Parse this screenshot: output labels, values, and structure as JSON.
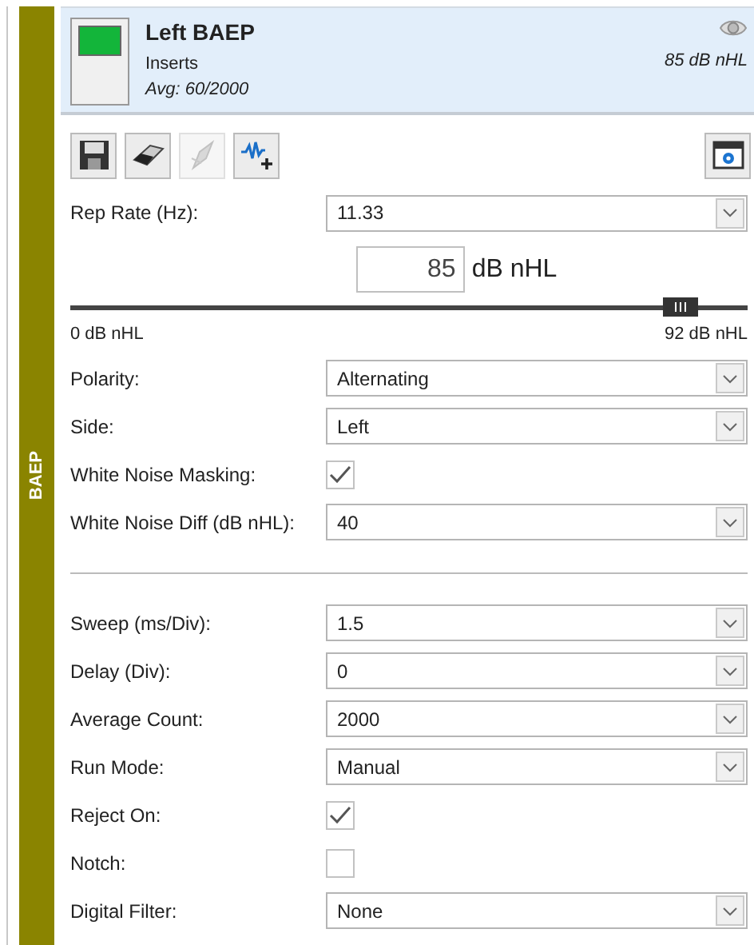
{
  "side_tab": {
    "label": "BAEP"
  },
  "header": {
    "title": "Left BAEP",
    "transducer": "Inserts",
    "average": "Avg: 60/2000",
    "intensity": "85 dB nHL",
    "visible": true
  },
  "toolbar": [
    {
      "kind": "save",
      "disabled": false
    },
    {
      "kind": "eraser",
      "disabled": false
    },
    {
      "kind": "marker",
      "disabled": true
    },
    {
      "kind": "add-wave",
      "disabled": false
    }
  ],
  "toolbar_right": {
    "kind": "settings",
    "disabled": false
  },
  "sections": [
    {
      "rows": [
        {
          "kind": "select",
          "label": "Rep Rate (Hz):",
          "value": "11.33"
        },
        {
          "kind": "slider",
          "value": "85",
          "unit": "dB nHL",
          "level": 0.9,
          "min_label": "0 dB nHL",
          "max_label": "92 dB nHL"
        },
        {
          "kind": "select",
          "label": "Polarity:",
          "value": "Alternating"
        },
        {
          "kind": "select",
          "label": "Side:",
          "value": "Left"
        },
        {
          "kind": "checkbox",
          "label": "White Noise Masking:",
          "checked": true
        },
        {
          "kind": "select",
          "label": "White Noise Diff (dB nHL):",
          "value": "40"
        }
      ]
    },
    {
      "rows": [
        {
          "kind": "select",
          "label": "Sweep (ms/Div):",
          "value": "1.5"
        },
        {
          "kind": "select",
          "label": "Delay (Div):",
          "value": "0"
        },
        {
          "kind": "select",
          "label": "Average Count:",
          "value": "2000"
        },
        {
          "kind": "select",
          "label": "Run Mode:",
          "value": "Manual"
        },
        {
          "kind": "checkbox",
          "label": "Reject On:",
          "checked": true
        },
        {
          "kind": "checkbox",
          "label": "Notch:",
          "checked": false
        },
        {
          "kind": "select",
          "label": "Digital Filter:",
          "value": "None"
        }
      ]
    }
  ]
}
